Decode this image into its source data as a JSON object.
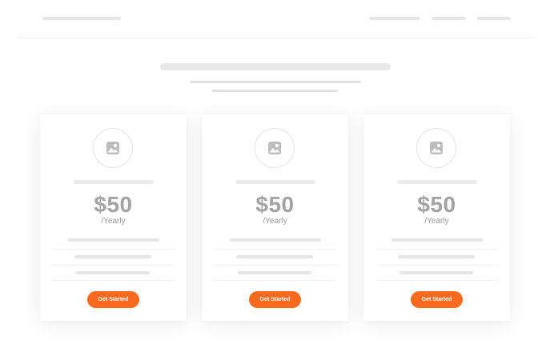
{
  "colors": {
    "accent": "#fa6a1e",
    "skeleton": "#e6e6e6",
    "price_text": "#a3a3a3"
  },
  "plans": [
    {
      "icon": "image-icon",
      "price": "$50",
      "period": "/Yearly",
      "cta_label": "Get Started"
    },
    {
      "icon": "image-icon",
      "price": "$50",
      "period": "/Yearly",
      "cta_label": "Get Started"
    },
    {
      "icon": "image-icon",
      "price": "$50",
      "period": "/Yearly",
      "cta_label": "Get Started"
    }
  ]
}
